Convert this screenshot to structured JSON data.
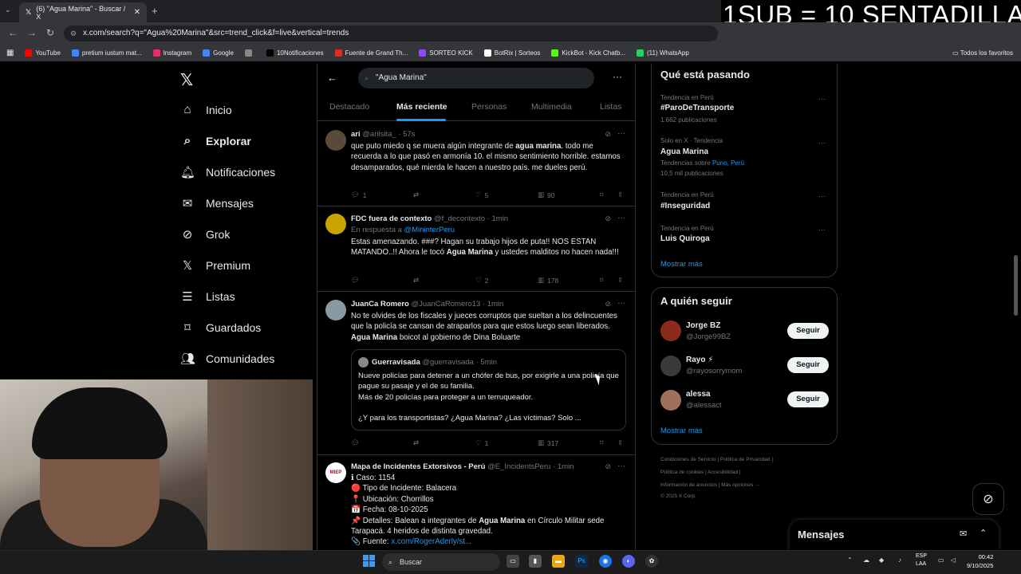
{
  "browser": {
    "tab_title": "(6) \"Agua Marina\" - Buscar / X",
    "url": "x.com/search?q=\"Agua%20Marina\"&src=trend_click&f=live&vertical=trends",
    "bookmarks": [
      {
        "label": "YouTube",
        "color": "#ff0000"
      },
      {
        "label": "pretium iustum mat...",
        "color": "#4285f4"
      },
      {
        "label": "Instagram",
        "color": "#e1306c"
      },
      {
        "label": "Google",
        "color": "#4285f4"
      },
      {
        "label": "",
        "color": "#888888"
      },
      {
        "label": "10Notificaciones",
        "color": "#000000"
      },
      {
        "label": "Fuente de Grand Th...",
        "color": "#d93025"
      },
      {
        "label": "SORTEO KICK",
        "color": "#9146ff"
      },
      {
        "label": "BotRix | Sorteos",
        "color": "#ffffff"
      },
      {
        "label": "KickBot - Kick Chatb...",
        "color": "#53fc18"
      },
      {
        "label": "(11) WhatsApp",
        "color": "#25d366"
      }
    ],
    "all_favorites": "Todos los favoritos"
  },
  "stream_overlay": "1SUB = 10 SENTADILLAS",
  "nav": {
    "items": [
      {
        "label": "Inicio",
        "icon": "home-icon"
      },
      {
        "label": "Explorar",
        "icon": "search-icon"
      },
      {
        "label": "Notificaciones",
        "icon": "bell-icon"
      },
      {
        "label": "Mensajes",
        "icon": "mail-icon"
      },
      {
        "label": "Grok",
        "icon": "grok-icon"
      },
      {
        "label": "Premium",
        "icon": "x-icon"
      },
      {
        "label": "Listas",
        "icon": "list-icon"
      },
      {
        "label": "Guardados",
        "icon": "bookmark-icon"
      },
      {
        "label": "Comunidades",
        "icon": "people-icon"
      }
    ]
  },
  "search": {
    "query": "\"Agua Marina\"",
    "tabs": [
      "Destacado",
      "Más reciente",
      "Personas",
      "Multimedia",
      "Listas"
    ]
  },
  "tweets": [
    {
      "name": "ari",
      "handle": "@arilsita_",
      "time": "57s",
      "text_before": "que puto miedo q se muera algún integrante de ",
      "bold": "agua marina",
      "text_after": ". todo me recuerda a lo que pasó en armonía 10. el mismo sentimiento horrible. estamos desamparados, qué mierda le hacen a nuestro país. me dueles perú.",
      "replies": "1",
      "reposts": "",
      "likes": "5",
      "views": "90"
    },
    {
      "name": "FDC fuera de contexto",
      "handle": "@f_decontexto",
      "time": "1min",
      "reply_prefix": "En respuesta a",
      "reply_to": "@MininterPeru",
      "text_before": "Estas amenazando. ###? Hagan su trabajo hijos de puta!! NOS ESTAN MATANDO..!!  Ahora le tocó ",
      "bold": "Agua Marina",
      "text_after": " y ustedes malditos no hacen nada!!!",
      "replies": "",
      "reposts": "",
      "likes": "2",
      "views": "178"
    },
    {
      "name": "JuanCa Romero",
      "handle": "@JuanCaRomero13",
      "time": "1min",
      "text_before": "No te olvides de los fiscales y jueces corruptos que sueltan a los delincuentes que la policía se cansan de atraparlos para que estos luego sean liberados. ",
      "bold": "Agua Marina",
      "text_after": " boicot al gobierno de Dina Boluarte",
      "quote": {
        "name": "Guerravisada",
        "handle": "@guerravisada",
        "time": "5min",
        "line1": "Nueve policías para detener a un chófer de bus, por exigirle a una policía que pague su pasaje y el de su familia.",
        "line2": "Más de 20 policías para proteger a un terruqueador.",
        "line3": "¿Y para los transportistas? ¿Agua Marina? ¿Las víctimas? Solo ..."
      },
      "replies": "",
      "reposts": "",
      "likes": "1",
      "views": "317"
    },
    {
      "name": "Mapa de Incidentes Extorsivos - Perú",
      "handle": "@E_IncidentsPeru",
      "time": "1min",
      "lines": [
        {
          "emoji": "ℹ",
          "text": "Caso: 1154"
        },
        {
          "emoji": "🔴",
          "text": "Tipo de Incidente: Balacera"
        },
        {
          "emoji": "📍",
          "text": "Ubicación: Chorrillos"
        },
        {
          "emoji": "📅",
          "text": "Fecha: 08-10-2025"
        }
      ],
      "detail_before": "Detalles: Balean a integrantes de ",
      "detail_bold": "Agua Marina",
      "detail_after": " en Círculo Militar sede Tarapacá. 4 heridos de distinta gravedad.",
      "source_label": "Fuente:",
      "source_link": "x.com/RogerAderly/st..."
    }
  ],
  "trends": {
    "title": "Qué está pasando",
    "items": [
      {
        "meta": "Tendencia en Perú",
        "name": "#ParoDeTransporte",
        "count": "1.662 publicaciones"
      },
      {
        "meta": "Solo en X · Tendencia",
        "name": "Agua Marina",
        "count": "Tendencias sobre",
        "count_links": "Puno, Perú",
        "count2": "10,5 mil publicaciones"
      },
      {
        "meta": "Tendencia en Perú",
        "name": "#Inseguridad",
        "count": ""
      },
      {
        "meta": "Tendencia en Perú",
        "name": "Luis Quiroga",
        "count": ""
      }
    ],
    "show_more": "Mostrar más"
  },
  "follow": {
    "title": "A quién seguir",
    "items": [
      {
        "name": "Jorge BZ",
        "handle": "@Jorge99BZ",
        "button": "Seguir"
      },
      {
        "name": "Rayo ⚡",
        "handle": "@rayosorrymom",
        "button": "Seguir"
      },
      {
        "name": "alessa",
        "handle": "@alessact",
        "button": "Seguir"
      }
    ],
    "show_more": "Mostrar más"
  },
  "footer": {
    "line1": "Condiciones de Servicio  |  Política de Privacidad  |",
    "line2": "Política de cookies  |  Accesibilidad  |",
    "line3": "Información de anuncios  |  Más opciones ···",
    "line4": "© 2025 X Corp."
  },
  "messages": {
    "title": "Mensajes"
  },
  "taskbar": {
    "search": "Buscar",
    "lang1": "ESP",
    "lang2": "LAA",
    "time": "00:42",
    "date": "9/10/2025"
  }
}
